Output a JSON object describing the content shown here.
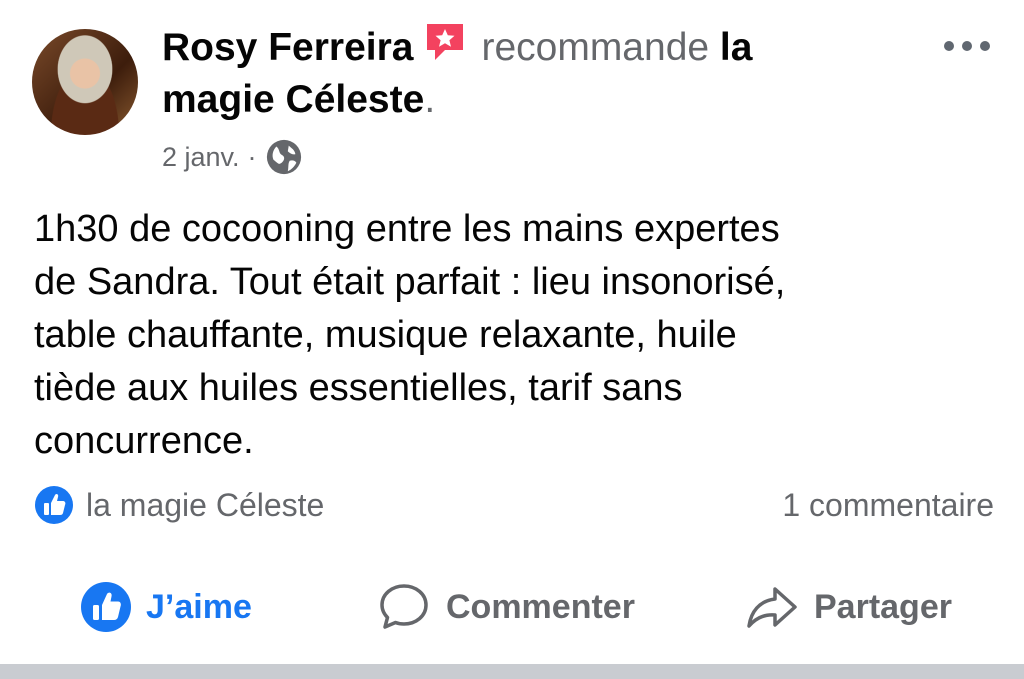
{
  "post": {
    "author": "Rosy Ferreira",
    "action": "recommande",
    "page_name_part1": "la",
    "page_name_part2": "magie Céleste",
    "period": ".",
    "date": "2 janv.",
    "separator": "·",
    "body_lines": [
      "1h30 de cocooning entre les mains expertes",
      "de Sandra. Tout était parfait : lieu insonorisé,",
      "table chauffante, musique relaxante, huile",
      "tiède aux huiles essentielles, tarif sans",
      "concurrence."
    ],
    "reactions_label": "la magie Céleste",
    "comments_count": "1 commentaire"
  },
  "actions": {
    "like": "J’aime",
    "comment": "Commenter",
    "share": "Partager"
  },
  "icons": {
    "recommend": "recommend-flag-icon",
    "privacy": "globe-icon",
    "more": "more-dots-icon",
    "like_badge": "like-thumb-icon",
    "comment": "speech-bubble-icon",
    "share": "share-arrow-icon"
  },
  "colors": {
    "brand_blue": "#1877f2",
    "recommend_red": "#f3425f",
    "muted": "#65676b"
  }
}
